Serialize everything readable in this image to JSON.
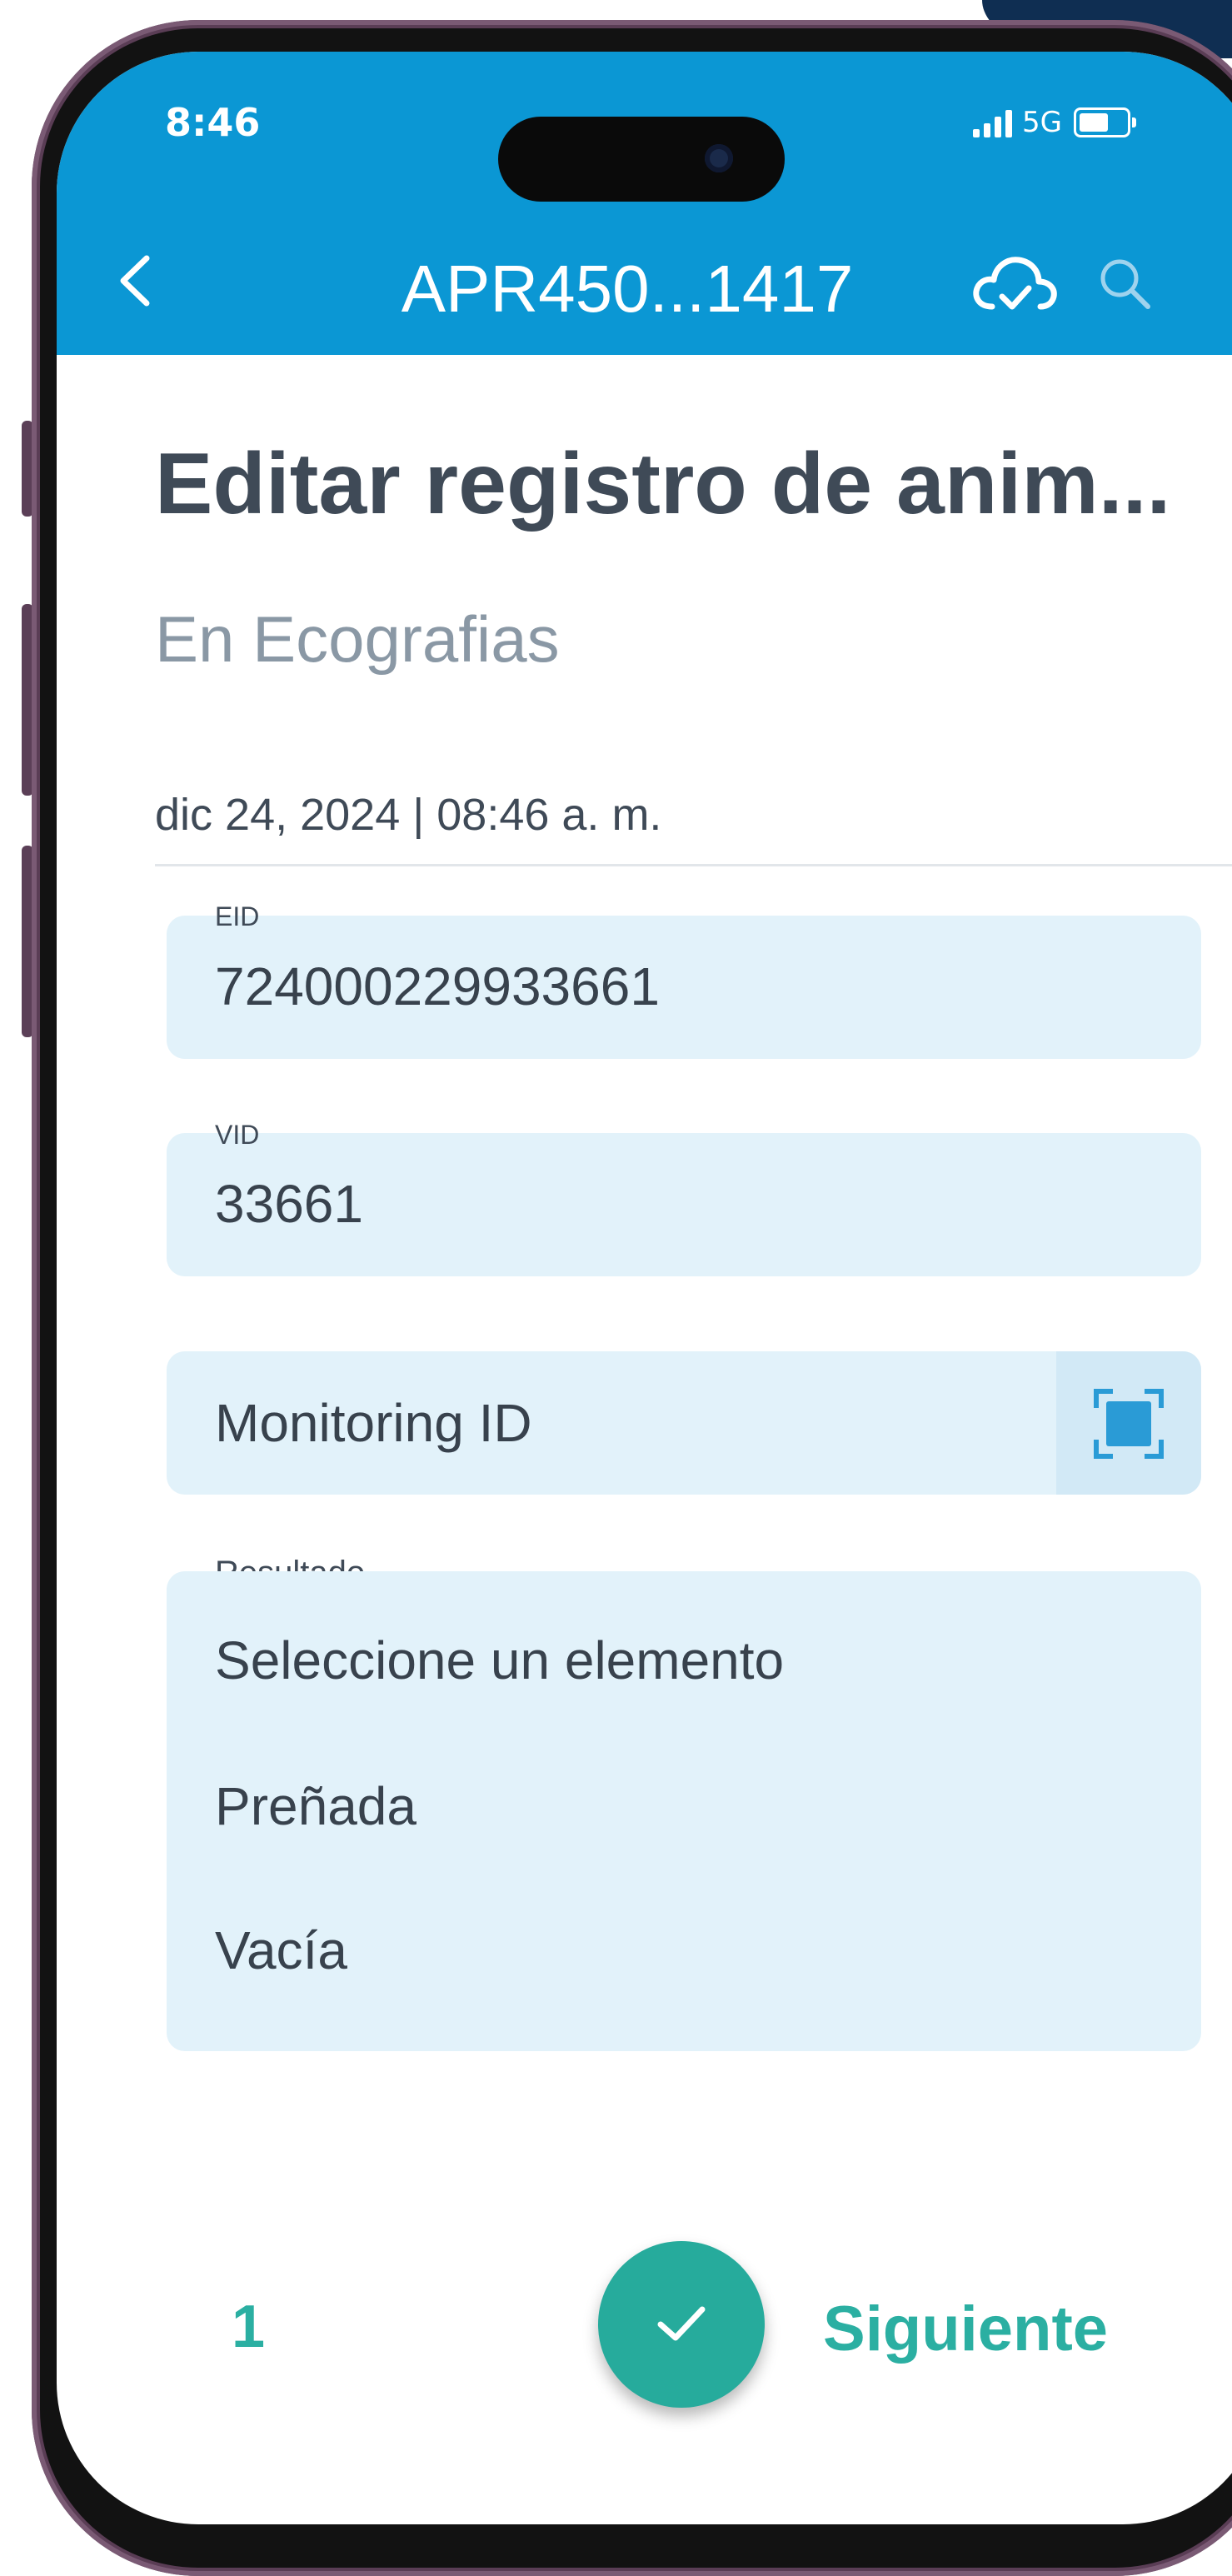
{
  "status_bar": {
    "time": "8:46",
    "network": "5G"
  },
  "header": {
    "title": "APR450...1417"
  },
  "page": {
    "title": "Editar registro de anim...",
    "subtitle": "En Ecografias",
    "date": "dic 24, 2024 | 08:46 a. m."
  },
  "fields": {
    "eid": {
      "label": "EID",
      "value": "724000229933661"
    },
    "vid": {
      "label": "VID",
      "value": "33661"
    },
    "monitoring": {
      "placeholder": "Monitoring ID"
    }
  },
  "resultado": {
    "label": "Resultado",
    "options": [
      "Seleccione un elemento",
      "Preñada",
      "Vacía"
    ]
  },
  "footer": {
    "page_number": "1",
    "next_label": "Siguiente"
  },
  "colors": {
    "header": "#0b97d4",
    "accent": "#26ab9c",
    "field_bg": "#e2f2fa",
    "title": "#3f4a57"
  },
  "icons": [
    "chevron-left-icon",
    "cloud-check-icon",
    "search-icon",
    "scan-icon",
    "check-icon",
    "signal-icon",
    "battery-icon"
  ]
}
